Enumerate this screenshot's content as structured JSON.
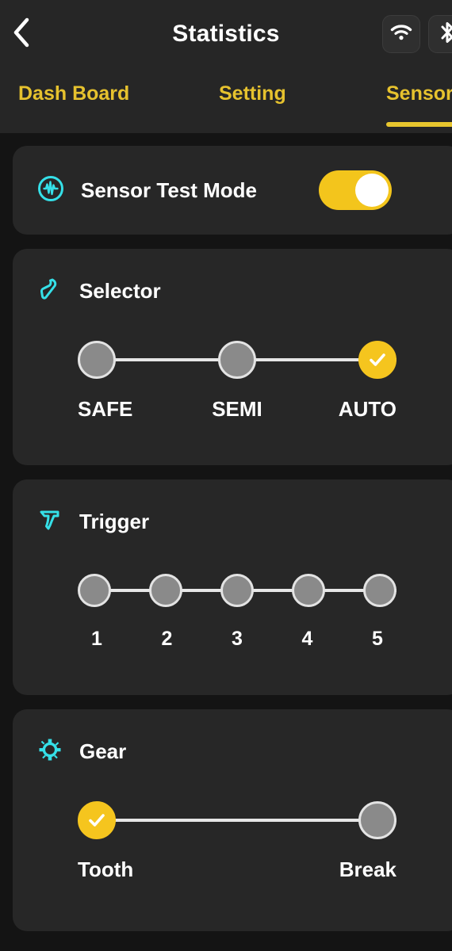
{
  "header": {
    "back_icon": "chevron-left-icon",
    "title": "Statistics",
    "status_icons": [
      {
        "name": "wifi-icon"
      },
      {
        "name": "bluetooth-icon"
      }
    ]
  },
  "tabs": {
    "items": [
      {
        "label": "Dash Board",
        "active": false
      },
      {
        "label": "Setting",
        "active": false
      },
      {
        "label": "Sensor",
        "active": true
      }
    ],
    "active_index": 2
  },
  "colors": {
    "accent_yellow": "#f5c51e",
    "tab_yellow": "#e6c22e",
    "icon_cyan": "#35e0e8",
    "node_gray": "#8a8a8a",
    "node_ring": "#e3e3e3",
    "card_bg": "#272727",
    "page_bg": "#141414",
    "header_bg": "#262626",
    "text_white": "#ffffff"
  },
  "sensor_test_mode": {
    "icon": "sensor-circle-icon",
    "label": "Sensor Test Mode",
    "toggle_on": true
  },
  "selector": {
    "icon": "fire-selector-icon",
    "label": "Selector",
    "options": [
      "SAFE",
      "SEMI",
      "AUTO"
    ],
    "selected_index": 2
  },
  "trigger": {
    "icon": "trigger-icon",
    "label": "Trigger",
    "options": [
      "1",
      "2",
      "3",
      "4",
      "5"
    ],
    "selected_index": -1
  },
  "gear": {
    "icon": "gear-icon",
    "label": "Gear",
    "options": [
      "Tooth",
      "Break"
    ],
    "selected_index": 0
  }
}
